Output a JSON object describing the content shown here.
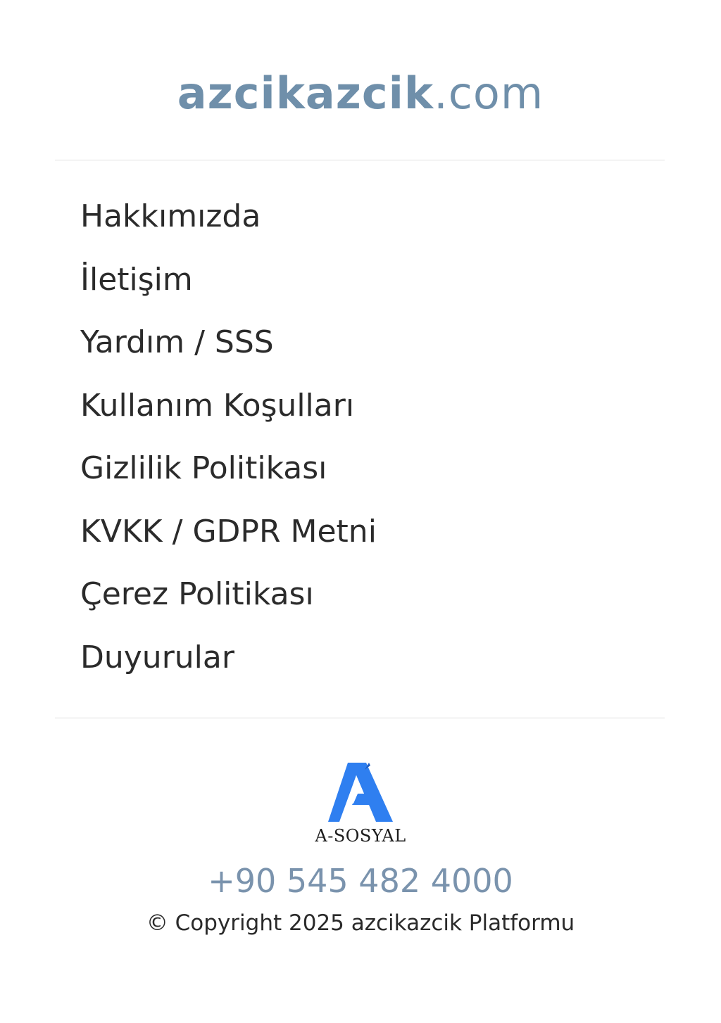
{
  "header": {
    "site_name": "azcikazcik",
    "site_tld": ".com"
  },
  "nav": {
    "items": [
      {
        "label": "Hakkımızda"
      },
      {
        "label": "İletişim"
      },
      {
        "label": "Yardım / SSS"
      },
      {
        "label": "Kullanım Koşulları"
      },
      {
        "label": "Gizlilik Politikası"
      },
      {
        "label": "KVKK / GDPR Metni"
      },
      {
        "label": "Çerez Politikası"
      },
      {
        "label": "Duyurular"
      }
    ]
  },
  "footer": {
    "logo_text": "A-SOSYAL",
    "phone": "+90 545 482 4000",
    "copyright": "© Copyright 2025 azcikazcik Platformu"
  },
  "colors": {
    "title": "#6f8faa",
    "logo_blue": "#2f7ff0",
    "phone": "#7a93ad",
    "text": "#2b2b2b"
  }
}
